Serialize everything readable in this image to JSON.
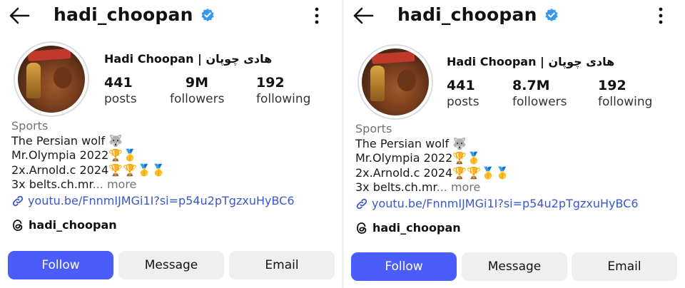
{
  "screens": [
    {
      "header": {
        "username": "hadi_choopan"
      },
      "profile": {
        "display_name": "Hadi Choopan | هادی چوپان",
        "stats": [
          {
            "value": "441",
            "label": "posts"
          },
          {
            "value": "9M",
            "label": "followers"
          },
          {
            "value": "192",
            "label": "following"
          }
        ]
      },
      "bio": {
        "category": "Sports",
        "line1": "The Persian wolf 🐺",
        "line2": "Mr.Olympia 2022🏆🥇",
        "line3": "2x.Arnold.c 2024🏆🏆🥇🥇",
        "line4": "3x belts.ch.mr",
        "more": "... more",
        "link": "youtu.be/FnnmIJMGi1I?si=p54u2pTgzxuHyBC6"
      },
      "threads": {
        "handle": "hadi_choopan"
      },
      "buttons": {
        "follow": "Follow",
        "message": "Message",
        "email": "Email"
      }
    },
    {
      "header": {
        "username": "hadi_choopan"
      },
      "profile": {
        "display_name": "Hadi Choopan | هادی چوپان",
        "stats": [
          {
            "value": "441",
            "label": "posts"
          },
          {
            "value": "8.7M",
            "label": "followers"
          },
          {
            "value": "192",
            "label": "following"
          }
        ]
      },
      "bio": {
        "category": "Sports",
        "line1": "The Persian wolf 🐺",
        "line2": "Mr.Olympia 2022🏆🥇",
        "line3": "2x.Arnold.c 2024🏆🏆🥇🥇",
        "line4": "3x belts.ch.mr",
        "more": "... more",
        "link": "youtu.be/FnnmIJMGi1I?si=p54u2pTgzxuHyBC6"
      },
      "threads": {
        "handle": "hadi_choopan"
      },
      "buttons": {
        "follow": "Follow",
        "message": "Message",
        "email": "Email"
      }
    }
  ],
  "colors": {
    "follow_button": "#4a5df9",
    "secondary_button": "#efefef",
    "link": "#3b57c9",
    "verified": "#3897f0",
    "muted_text": "#737373"
  }
}
